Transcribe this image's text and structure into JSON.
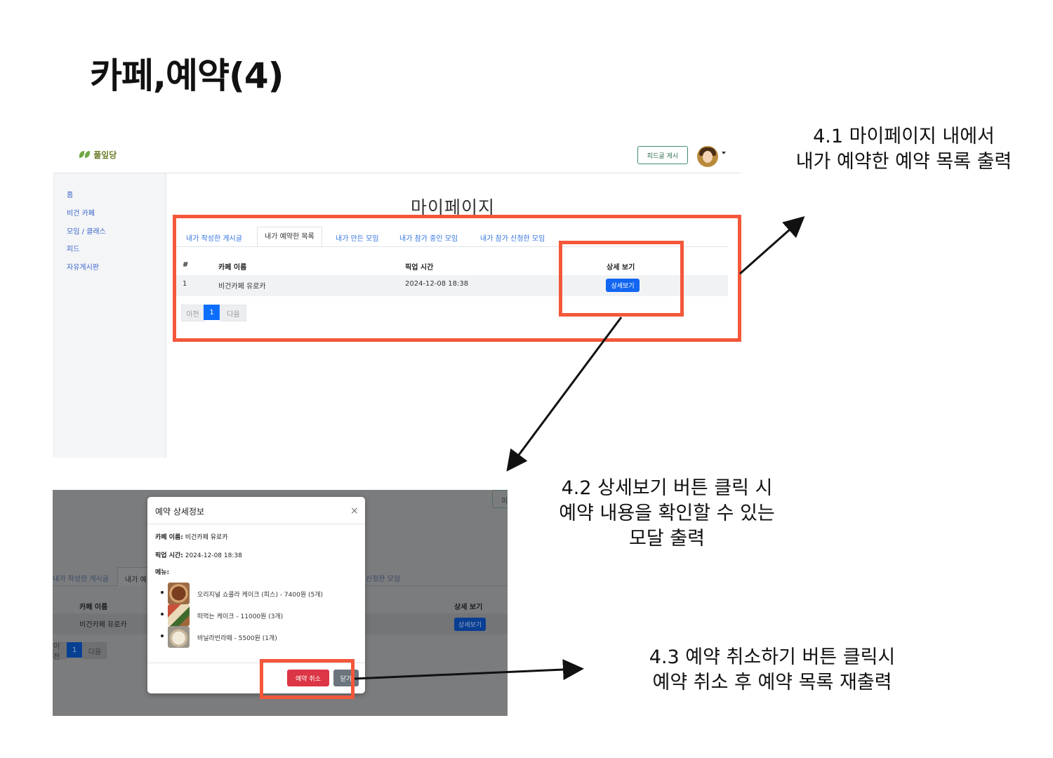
{
  "slide": {
    "title": "카페,예약(4)"
  },
  "screen1": {
    "logo": "풀잎당",
    "feed_button": "피드글 게시",
    "sidebar": [
      "홈",
      "비건 카페",
      "모임 / 클래스",
      "피드",
      "자유게시판"
    ],
    "page_title": "마이페이지",
    "tabs": [
      "내가 작성한 게시글",
      "내가 예약한 목록",
      "내가 만든 모임",
      "내가 참가 중인 모임",
      "내가 참가 신청한 모임"
    ],
    "active_tab": "내가 예약한 목록",
    "table": {
      "headers": [
        "#",
        "카페 이름",
        "픽업 시간",
        "상세 보기"
      ],
      "rows": [
        {
          "num": "1",
          "cafe": "비건카페 유로카",
          "pickup": "2024-12-08 18:38",
          "action": "상세보기"
        }
      ]
    },
    "pagination": {
      "prev": "이전",
      "current": "1",
      "next": "다음"
    }
  },
  "screen2": {
    "bg": {
      "tab_partial_1": "내가 작성한 게시글",
      "tab_partial_2": "내가 예",
      "tab_partial_3": "신청한 모임",
      "header_cafe": "카페 이름",
      "header_detail": "상세 보기",
      "row_cafe": "비건카페 유로카",
      "detail_button": "상세보기",
      "pager_prev": "이전",
      "pager_current": "1",
      "pager_next": "다음",
      "feed_btn_partial": "피"
    },
    "modal": {
      "title": "예약 상세정보",
      "close_icon": "×",
      "cafe_label": "카페 이름:",
      "cafe_value": "비건카페 유로카",
      "pickup_label": "픽업 시간:",
      "pickup_value": "2024-12-08 18:38",
      "menu_label": "메뉴:",
      "menu_items": [
        {
          "text": "오리지널 쇼콜라 케이크 (피스) - 7400원 (5개)"
        },
        {
          "text": "떠먹는 케이크 - 11000원 (3개)"
        },
        {
          "text": "바닐라빈라떼 - 5500원 (1개)"
        }
      ],
      "cancel_button": "예약 취소",
      "close_button": "닫기"
    }
  },
  "annotations": {
    "callout_1": [
      "4.1 마이페이지 내에서",
      "내가 예약한 예약 목록 출력"
    ],
    "callout_2": [
      "4.2 상세보기 버튼 클릭 시",
      "예약 내용을 확인할 수 있는",
      "모달 출력"
    ],
    "callout_3": [
      "4.3 예약 취소하기 버튼 클릭시",
      "예약 취소 후 예약 목록 재출력"
    ],
    "highlight_color": "#f4573a"
  }
}
